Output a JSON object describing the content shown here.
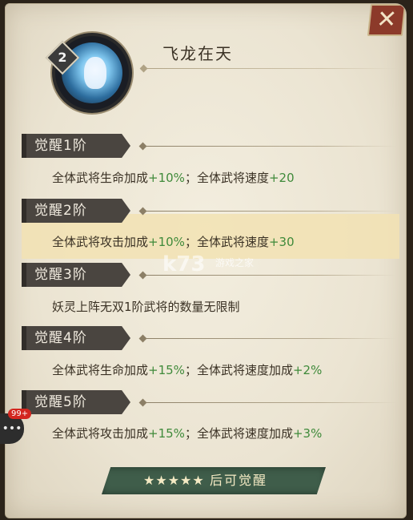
{
  "title": "飞龙在天",
  "level": "2",
  "tiers": [
    {
      "label": "觉醒1阶",
      "text_parts": [
        {
          "t": "全体武将生命加成"
        },
        {
          "t": "+10%",
          "v": true
        },
        {
          "t": "；全体武将速度"
        },
        {
          "t": "+20",
          "v": true
        }
      ]
    },
    {
      "label": "觉醒2阶",
      "text_parts": [
        {
          "t": "全体武将攻击加成"
        },
        {
          "t": "+10%",
          "v": true
        },
        {
          "t": "；全体武将速度"
        },
        {
          "t": "+30",
          "v": true
        }
      ]
    },
    {
      "label": "觉醒3阶",
      "text_parts": [
        {
          "t": "妖灵上阵无双1阶武将的数量无限制"
        }
      ]
    },
    {
      "label": "觉醒4阶",
      "text_parts": [
        {
          "t": "全体武将生命加成"
        },
        {
          "t": "+15%",
          "v": true
        },
        {
          "t": "；全体武将速度加成"
        },
        {
          "t": "+2%",
          "v": true
        }
      ]
    },
    {
      "label": "觉醒5阶",
      "text_parts": [
        {
          "t": "全体武将攻击加成"
        },
        {
          "t": "+15%",
          "v": true
        },
        {
          "t": "；全体武将速度加成"
        },
        {
          "t": "+3%",
          "v": true
        }
      ]
    }
  ],
  "bottom": {
    "stars": "★★★★★",
    "label": "后可觉醒"
  },
  "chat_badge": "99+",
  "watermark": {
    "main": "k73",
    "sub": "游戏之家"
  },
  "colors": {
    "value_green": "#3f8a3a",
    "banner": "#3f5d4a",
    "highlight": "#f2e2b3"
  },
  "icons": {
    "close": "close-icon",
    "chat": "chat-icon",
    "portrait": "spirit-portrait"
  }
}
